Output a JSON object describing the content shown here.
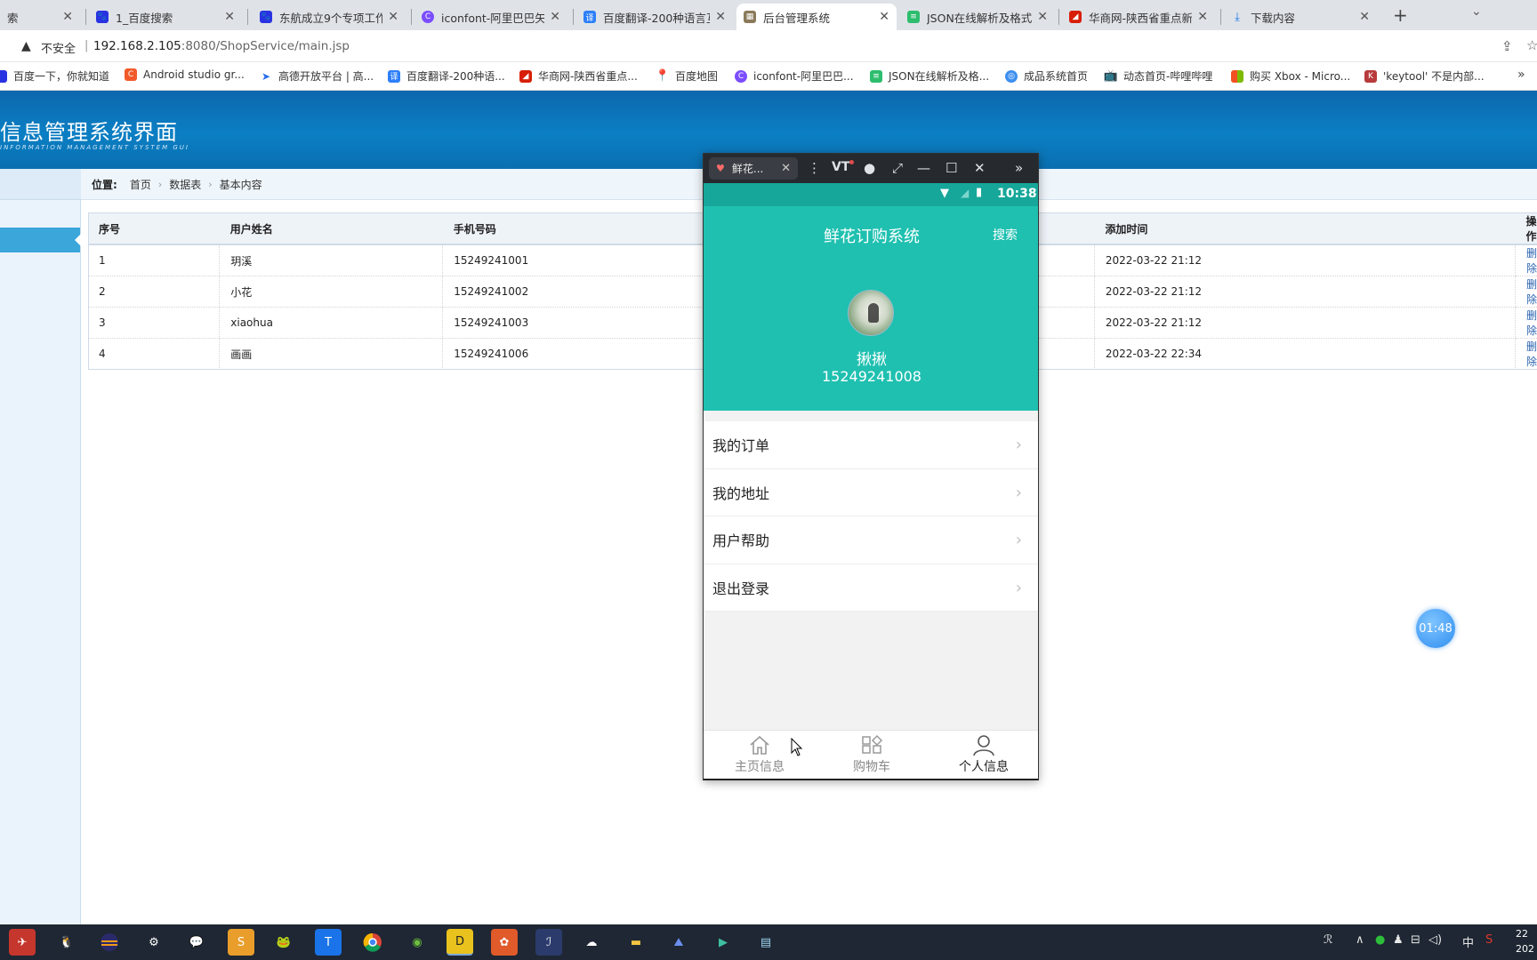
{
  "browser": {
    "tabs": [
      {
        "title": "索",
        "icon": "baidu",
        "color": "#2932e1",
        "active": false
      },
      {
        "title": "1_百度搜索",
        "icon": "baidu",
        "color": "#2932e1",
        "active": false
      },
      {
        "title": "东航成立9个专项工作",
        "icon": "baidu",
        "color": "#2932e1",
        "active": false
      },
      {
        "title": "iconfont-阿里巴巴矢",
        "icon": "iconfont",
        "color": "#7b4dff",
        "active": false
      },
      {
        "title": "百度翻译-200种语言互",
        "icon": "translate",
        "color": "#2d7ff9",
        "active": false
      },
      {
        "title": "后台管理系统",
        "icon": "admin",
        "color": "#8a7a5a",
        "active": true
      },
      {
        "title": "JSON在线解析及格式",
        "icon": "json",
        "color": "#2dbd6e",
        "active": false
      },
      {
        "title": "华商网-陕西省重点新",
        "icon": "hsw",
        "color": "#d81e06",
        "active": false
      },
      {
        "title": "下载内容",
        "icon": "download",
        "color": "#1a73e8",
        "active": false
      }
    ],
    "new_tab": "+",
    "security": "不安全",
    "url_host": "192.168.2.105",
    "url_rest": ":8080/ShopService/main.jsp",
    "bookmarks": [
      {
        "label": "百度一下，你就知道",
        "color": "#2932e1"
      },
      {
        "label": "Android studio gr...",
        "color": "#f25a29"
      },
      {
        "label": "高德开放平台 | 高...",
        "color": "#2a6ee8"
      },
      {
        "label": "百度翻译-200种语...",
        "color": "#2d7ff9"
      },
      {
        "label": "华商网-陕西省重点...",
        "color": "#d81e06"
      },
      {
        "label": "百度地图",
        "color": "#e03b3b"
      },
      {
        "label": "iconfont-阿里巴巴...",
        "color": "#7b4dff"
      },
      {
        "label": "JSON在线解析及格...",
        "color": "#2dbd6e"
      },
      {
        "label": "成品系统首页",
        "color": "#3d8ef0"
      },
      {
        "label": "动态首页-哔哩哔哩",
        "color": "#1c9dd9"
      },
      {
        "label": "购买 Xbox - Micro...",
        "color": "#f25022"
      },
      {
        "label": "'keytool' 不是内部...",
        "color": "#b83b3b"
      }
    ]
  },
  "admin": {
    "title": "信息管理系统界面",
    "subtitle": "INFORMATION MANAGEMENT SYSTEM GUI",
    "breadcrumb": {
      "label": "位置:",
      "items": [
        "首页",
        "数据表",
        "基本内容"
      ]
    },
    "table": {
      "headers": [
        "序号",
        "用户姓名",
        "手机号码",
        "",
        "添加时间",
        "操作"
      ],
      "rows": [
        {
          "no": "1",
          "name": "玥溪",
          "phone": "15249241001",
          "time": "2022-03-22 21:12",
          "action": "删除"
        },
        {
          "no": "2",
          "name": "小花",
          "phone": "15249241002",
          "time": "2022-03-22 21:12",
          "action": "删除"
        },
        {
          "no": "3",
          "name": "xiaohua",
          "phone": "15249241003",
          "time": "2022-03-22 21:12",
          "action": "删除"
        },
        {
          "no": "4",
          "name": "画画",
          "phone": "15249241006",
          "time": "2022-03-22 22:34",
          "action": "删除"
        }
      ]
    },
    "timer": "01:48"
  },
  "emulator": {
    "tab_title": "鲜花...",
    "vt_label": "VT",
    "status_time": "10:38",
    "app_title": "鲜花订购系统",
    "search": "搜索",
    "user_name": "揪揪",
    "user_phone": "15249241008",
    "menu": [
      "我的订单",
      "我的地址",
      "用户帮助",
      "退出登录"
    ],
    "nav": [
      {
        "label": "主页信息",
        "icon": "home-icon",
        "active": false
      },
      {
        "label": "购物车",
        "icon": "cart-icon",
        "active": false
      },
      {
        "label": "个人信息",
        "icon": "person-icon",
        "active": true
      }
    ]
  },
  "taskbar": {
    "ime": "中",
    "clock_top": "22",
    "clock_bottom": "202"
  }
}
